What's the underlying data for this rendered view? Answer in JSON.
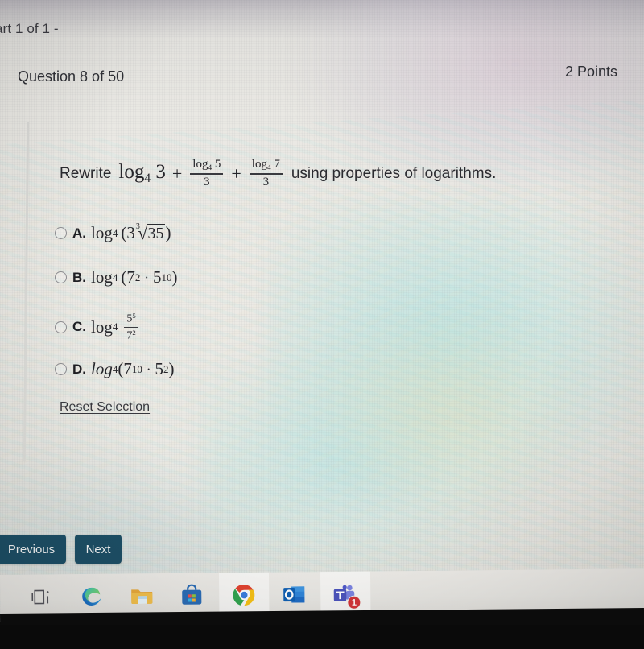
{
  "header": {
    "part_label": "art 1 of 1 -",
    "question_number": "Question 8 of 50",
    "points": "2 Points"
  },
  "question": {
    "lead": "Rewrite",
    "trailing": "using properties of logarithms.",
    "terms": {
      "first_log": "log",
      "first_base": "4",
      "first_arg": "3",
      "plus": "+",
      "frac1_num_log": "log",
      "frac1_num_base": "4",
      "frac1_num_arg": "5",
      "frac1_den": "3",
      "frac2_num_log": "log",
      "frac2_num_base": "4",
      "frac2_num_arg": "7",
      "frac2_den": "3"
    }
  },
  "options": [
    {
      "letter": "A.",
      "log": "log",
      "base": "4",
      "open": "(",
      "coefficient": "3",
      "root_index": "3",
      "root_sign": "√",
      "radicand": "35",
      "close": ")",
      "expression_text": "log_4(3 cbrt(35))"
    },
    {
      "letter": "B.",
      "log": "log",
      "base": "4",
      "open": "(",
      "left_base": "7",
      "left_exp": "2",
      "dot": "·",
      "right_base": "5",
      "right_exp": "10",
      "close": ")",
      "expression_text": "log_4(7^2 . 5^10)"
    },
    {
      "letter": "C.",
      "log": "log",
      "base": "4",
      "num_base": "5",
      "num_exp": "5",
      "den_base": "7",
      "den_exp": "2",
      "expression_text": "log_4 (5^5 / 7^2)"
    },
    {
      "letter": "D.",
      "log": "log",
      "base": "4",
      "open": "(",
      "left_base": "7",
      "left_exp": "10",
      "dot": "·",
      "right_base": "5",
      "right_exp": "2",
      "close": ")",
      "expression_text": "log_4(7^10 . 5^2)"
    }
  ],
  "reset_link": "Reset Selection",
  "nav": {
    "previous": "Previous",
    "next": "Next"
  },
  "taskbar": {
    "items": [
      {
        "name": "task-view",
        "label": "Task View",
        "active": false
      },
      {
        "name": "microsoft-edge",
        "label": "Microsoft Edge",
        "active": false
      },
      {
        "name": "file-explorer",
        "label": "File Explorer",
        "active": false
      },
      {
        "name": "microsoft-store",
        "label": "Microsoft Store",
        "active": false
      },
      {
        "name": "google-chrome",
        "label": "Google Chrome",
        "active": true
      },
      {
        "name": "outlook",
        "label": "Outlook",
        "active": false
      },
      {
        "name": "microsoft-teams",
        "label": "Microsoft Teams",
        "active": true,
        "badge": "1"
      }
    ]
  },
  "colors": {
    "button_bg": "#1d4f66",
    "button_text": "#f2f4f4",
    "link_text": "#39393f",
    "badge_bg": "#d13438",
    "taskbar_active_underline": "#3a87d4",
    "page_bg": "#eceae5",
    "text": "#26262b"
  }
}
